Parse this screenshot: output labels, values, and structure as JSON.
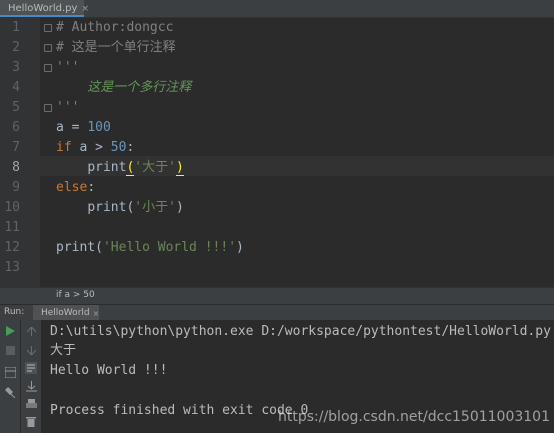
{
  "editor_tab": {
    "label": "HelloWorld.py",
    "close": "×"
  },
  "line_numbers": [
    "1",
    "2",
    "3",
    "4",
    "5",
    "6",
    "7",
    "8",
    "9",
    "10",
    "11",
    "12",
    "13"
  ],
  "code": {
    "l1": "# Author:dongcc",
    "l2": "# 这是一个单行注释",
    "l3": "'''",
    "l4": "    这是一个多行注释",
    "l5": "'''",
    "l6_var": "a",
    "l6_op": " = ",
    "l6_num": "100",
    "l7_kw": "if",
    "l7_mid": " a > ",
    "l7_num": "50",
    "l7_end": ":",
    "l8_indent": "    ",
    "l8_fn": "print",
    "l8_open": "(",
    "l8_str": "'大于'",
    "l8_close": ")",
    "l9_kw": "else",
    "l9_end": ":",
    "l10_indent": "    ",
    "l10_fn": "print(",
    "l10_str": "'小于'",
    "l10_close": ")",
    "l12_fn": "print(",
    "l12_str": "'Hello World !!!'",
    "l12_close": ")"
  },
  "breadcrumb": "if a > 50",
  "run": {
    "label": "Run:",
    "tab_label": "HelloWorld",
    "tab_close": "×",
    "output": [
      "D:\\utils\\python\\python.exe D:/workspace/pythontest/HelloWorld.py",
      "大于",
      "Hello World !!!",
      "",
      "Process finished with exit code 0"
    ]
  },
  "icons": {
    "run": "play-icon",
    "stop": "stop-icon",
    "up": "arrow-up-icon",
    "down": "arrow-down-icon"
  },
  "watermark": "https://blog.csdn.net/dcc15011003101"
}
